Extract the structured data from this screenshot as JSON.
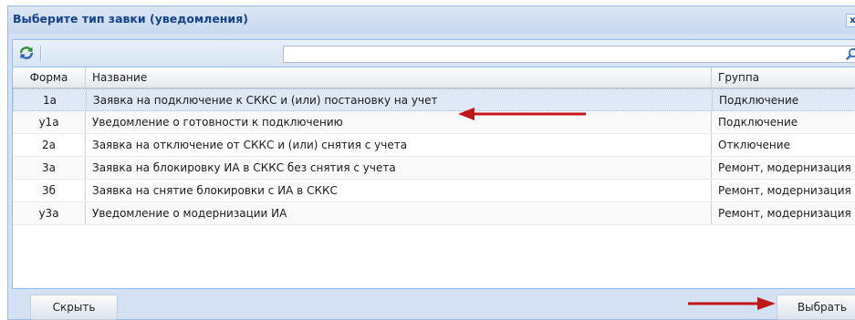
{
  "dialog": {
    "title": "Выберите тип завки (уведомления)",
    "close_glyph": "x"
  },
  "toolbar": {
    "refresh_icon": "refresh-icon",
    "search_placeholder": "",
    "search_icon": "search-icon"
  },
  "grid": {
    "columns": [
      "Форма",
      "Название",
      "Группа"
    ],
    "rows": [
      {
        "form": "1а",
        "name": "Заявка на подключение к СККС и (или) постановку на учет",
        "group": "Подключение",
        "selected": true
      },
      {
        "form": "у1а",
        "name": "Уведомление о готовности к подключению",
        "group": "Подключение"
      },
      {
        "form": "2а",
        "name": "Заявка на отключение от СККС и (или) снятия с учета",
        "group": "Отключение"
      },
      {
        "form": "3а",
        "name": "Заявка на блокировку ИА в СККС без снятия с учета",
        "group": "Ремонт, модернизация"
      },
      {
        "form": "3б",
        "name": "Заявка на снятие блокировки с ИА в СККС",
        "group": "Ремонт, модернизация"
      },
      {
        "form": "у3а",
        "name": "Уведомление о модернизации ИА",
        "group": "Ремонт, модернизация"
      }
    ]
  },
  "buttons": {
    "hide": "Скрыть",
    "select": "Выбрать"
  },
  "colors": {
    "title_text": "#15428b",
    "selected_row": "#dfe8f6",
    "arrow": "#c0161a"
  }
}
